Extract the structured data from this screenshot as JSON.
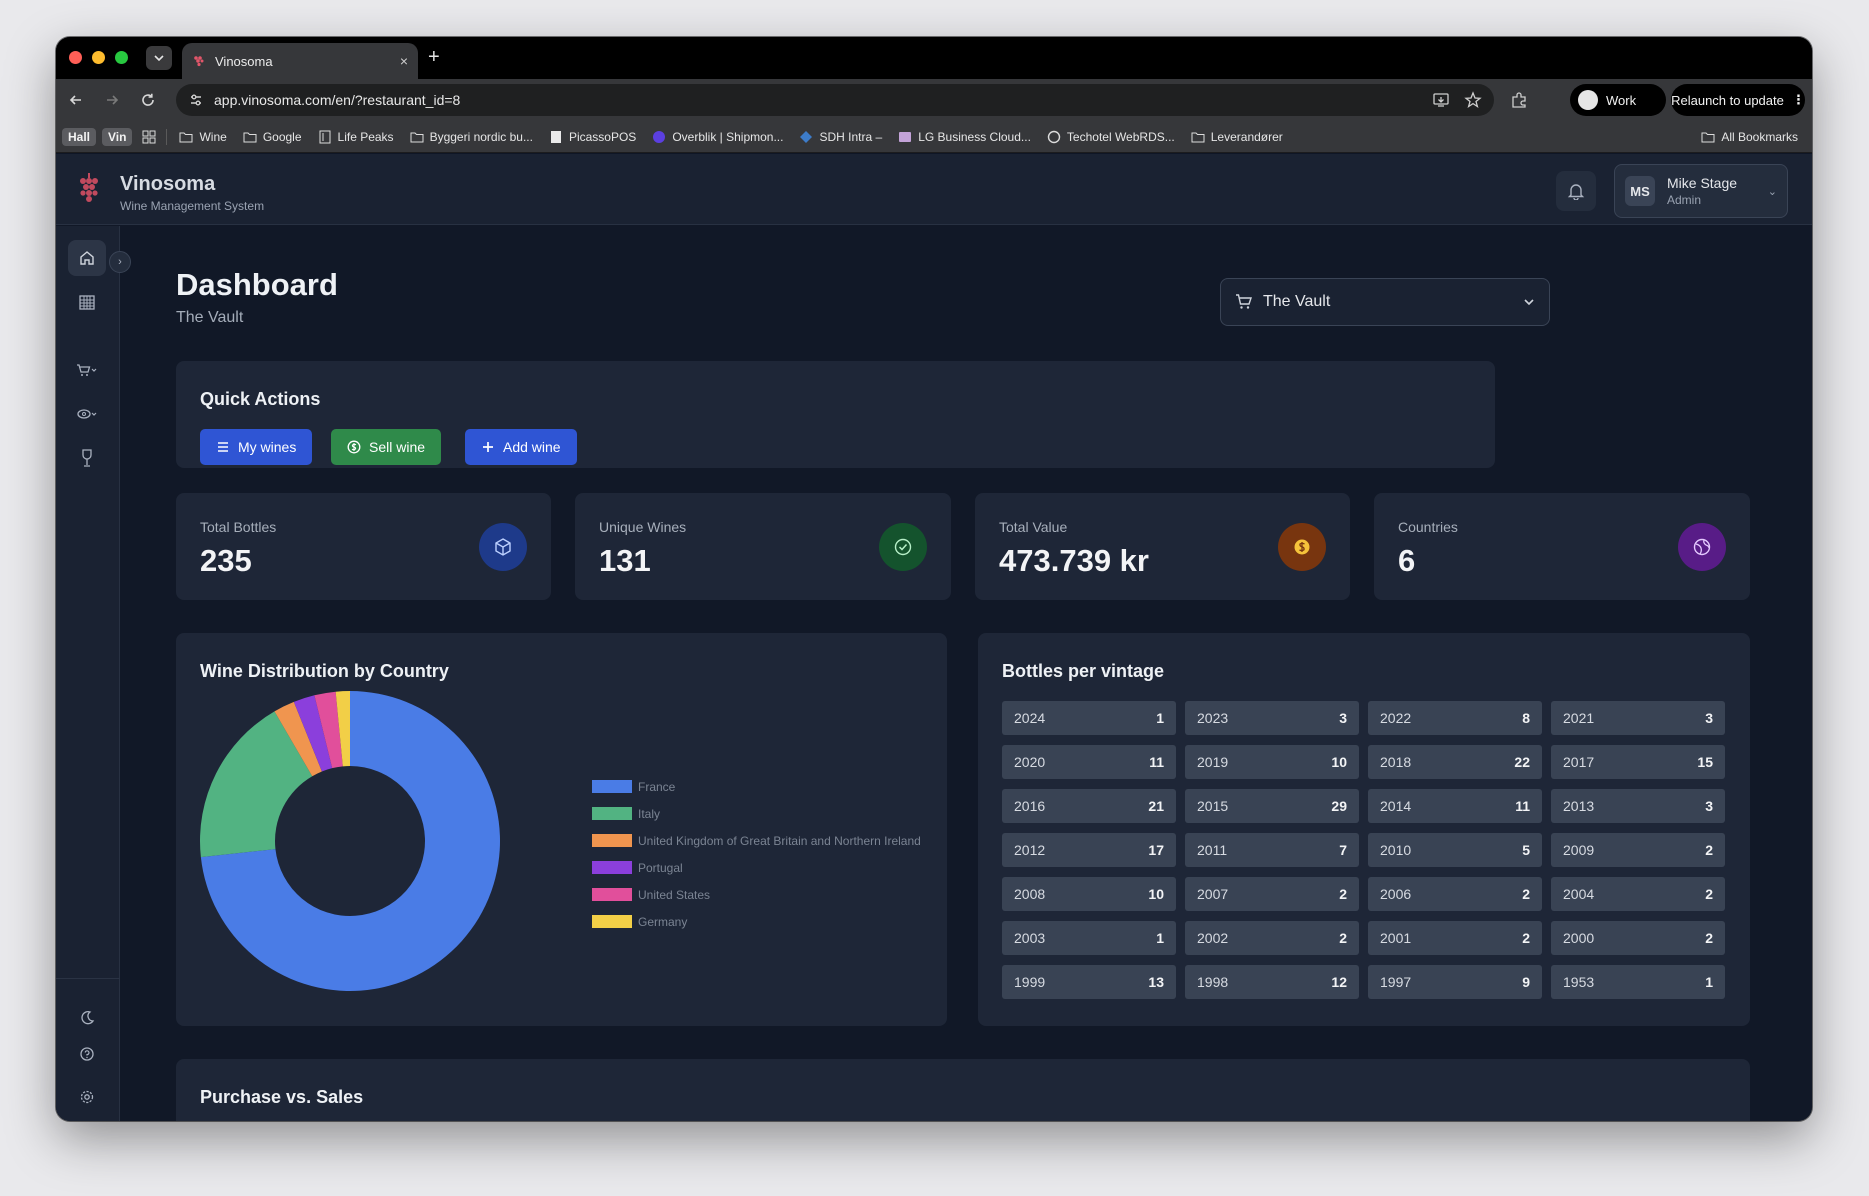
{
  "browser": {
    "tab_title": "Vinosoma",
    "tab_close": "×",
    "new_tab": "+",
    "url": "app.vinosoma.com/en/?restaurant_id=8",
    "profile_label": "Work",
    "relaunch_label": "Relaunch to update",
    "bookmarks": {
      "pills": [
        "Hall",
        "Vin"
      ],
      "items": [
        {
          "label": "Wine",
          "icon": "folder-icon"
        },
        {
          "label": "Google",
          "icon": "folder-icon"
        },
        {
          "label": "Life Peaks",
          "icon": "page-icon"
        },
        {
          "label": "Byggeri nordic bu...",
          "icon": "folder-icon"
        },
        {
          "label": "PicassoPOS",
          "icon": "page-icon"
        },
        {
          "label": "Overblik | Shipmon...",
          "icon": "globe-icon"
        },
        {
          "label": "SDH Intra –",
          "icon": "globe-icon"
        },
        {
          "label": "LG Business Cloud...",
          "icon": "page-icon"
        },
        {
          "label": "Techotel WebRDS...",
          "icon": "globe-icon"
        },
        {
          "label": "Leverandører",
          "icon": "folder-icon"
        }
      ],
      "all_bookmarks": "All Bookmarks"
    }
  },
  "app": {
    "brand": "Vinosoma",
    "brand_sub": "Wine Management System",
    "user": {
      "initials": "MS",
      "name": "Mike Stage",
      "role": "Admin"
    }
  },
  "page": {
    "title": "Dashboard",
    "subtitle": "The Vault",
    "restaurant_select": "The Vault"
  },
  "quick_actions": {
    "title": "Quick Actions",
    "buttons": [
      {
        "label": "My wines",
        "color": "#2f55d4"
      },
      {
        "label": "Sell wine",
        "color": "#2f8a4a"
      },
      {
        "label": "Add wine",
        "color": "#2f55d4"
      }
    ]
  },
  "stats": [
    {
      "label": "Total Bottles",
      "value": "235",
      "icon": "box-icon",
      "color": "#1e3a8a"
    },
    {
      "label": "Unique Wines",
      "value": "131",
      "icon": "check-circle-icon",
      "color": "#14532d"
    },
    {
      "label": "Total Value",
      "value": "473.739 kr",
      "icon": "dollar-circle-icon",
      "color": "#78350f"
    },
    {
      "label": "Countries",
      "value": "6",
      "icon": "globe-icon",
      "color": "#581c87"
    }
  ],
  "chart_data": {
    "type": "pie",
    "title": "Wine Distribution by Country",
    "categories": [
      "France",
      "Italy",
      "United Kingdom of Great Britain and Northern Ireland",
      "Portugal",
      "United States",
      "Germany"
    ],
    "values": [
      96,
      24,
      3,
      3,
      3,
      2
    ],
    "colors": [
      "#4a7ce6",
      "#52b382",
      "#f0954f",
      "#8b3fdc",
      "#e14f9b",
      "#f2cf47"
    ],
    "donut": true,
    "legend_position": "right"
  },
  "vintages": {
    "title": "Bottles per vintage",
    "items": [
      {
        "year": "2024",
        "count": "1"
      },
      {
        "year": "2023",
        "count": "3"
      },
      {
        "year": "2022",
        "count": "8"
      },
      {
        "year": "2021",
        "count": "3"
      },
      {
        "year": "2020",
        "count": "11"
      },
      {
        "year": "2019",
        "count": "10"
      },
      {
        "year": "2018",
        "count": "22"
      },
      {
        "year": "2017",
        "count": "15"
      },
      {
        "year": "2016",
        "count": "21"
      },
      {
        "year": "2015",
        "count": "29"
      },
      {
        "year": "2014",
        "count": "11"
      },
      {
        "year": "2013",
        "count": "3"
      },
      {
        "year": "2012",
        "count": "17"
      },
      {
        "year": "2011",
        "count": "7"
      },
      {
        "year": "2010",
        "count": "5"
      },
      {
        "year": "2009",
        "count": "2"
      },
      {
        "year": "2008",
        "count": "10"
      },
      {
        "year": "2007",
        "count": "2"
      },
      {
        "year": "2006",
        "count": "2"
      },
      {
        "year": "2004",
        "count": "2"
      },
      {
        "year": "2003",
        "count": "1"
      },
      {
        "year": "2002",
        "count": "2"
      },
      {
        "year": "2001",
        "count": "2"
      },
      {
        "year": "2000",
        "count": "2"
      },
      {
        "year": "1999",
        "count": "13"
      },
      {
        "year": "1998",
        "count": "12"
      },
      {
        "year": "1997",
        "count": "9"
      },
      {
        "year": "1953",
        "count": "1"
      }
    ]
  },
  "purchase_vs_sales": {
    "title": "Purchase vs. Sales"
  }
}
